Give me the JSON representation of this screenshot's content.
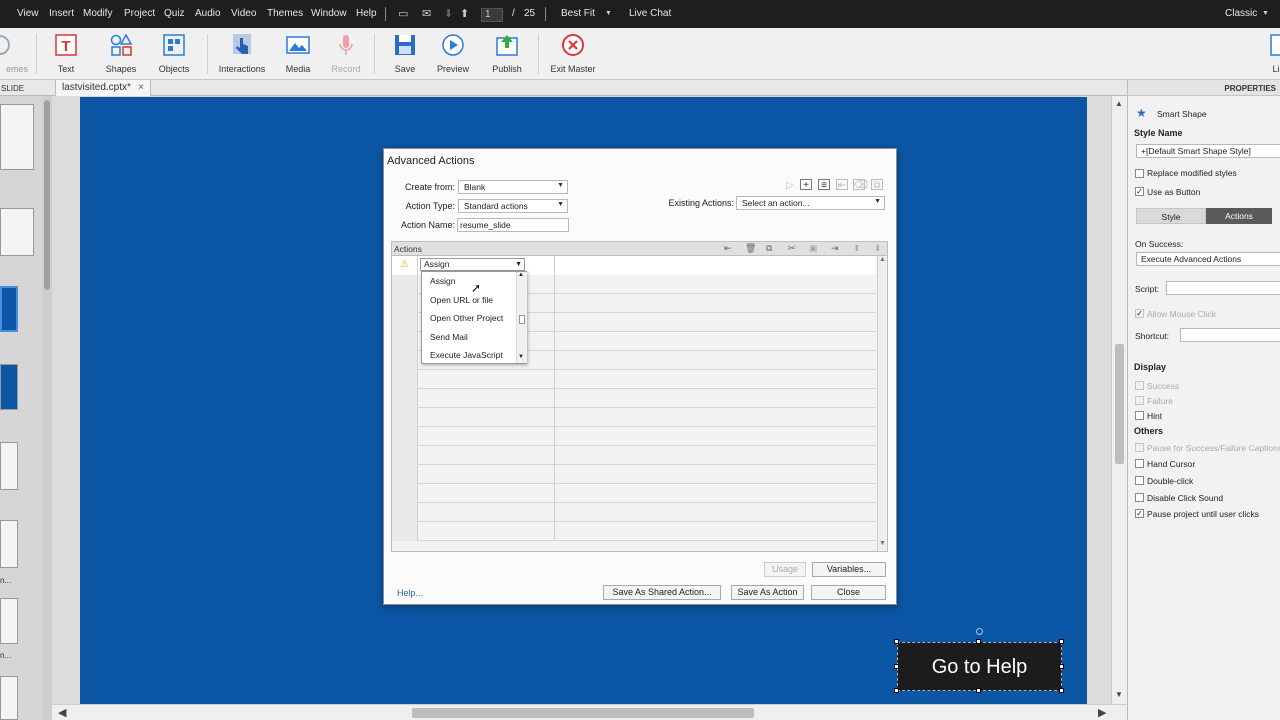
{
  "menubar": {
    "items": [
      "View",
      "Insert",
      "Modify",
      "Project",
      "Quiz",
      "Audio",
      "Video",
      "Themes",
      "Window",
      "Help"
    ],
    "page_current": "1",
    "page_sep": "/",
    "page_total": "25",
    "zoom": "Best Fit",
    "live_chat": "Live Chat",
    "mode": "Classic"
  },
  "toolbar": {
    "left_partial": "emes",
    "text": "Text",
    "shapes": "Shapes",
    "objects": "Objects",
    "interactions": "Interactions",
    "media": "Media",
    "record": "Record",
    "save": "Save",
    "preview": "Preview",
    "publish": "Publish",
    "exit_master": "Exit Master",
    "library": "Library"
  },
  "tabs": {
    "left_panel": "SLIDE",
    "document": "lastvisited.cptx*",
    "close": "×"
  },
  "filmstrip": {
    "labels": [
      "n...",
      "n..."
    ]
  },
  "slide": {
    "button_label": "Go to Help"
  },
  "dialog": {
    "title": "Advanced Actions",
    "create_from_label": "Create from:",
    "create_from_value": "Blank",
    "action_type_label": "Action Type:",
    "action_type_value": "Standard actions",
    "action_name_label": "Action Name:",
    "action_name_value": "resume_slide",
    "existing_actions_label": "Existing Actions:",
    "existing_actions_value": "Select an action...",
    "grid_header": "Actions",
    "row_selected": "Assign",
    "dropdown_options": [
      "Assign",
      "Open URL or file",
      "Open Other Project",
      "Send Mail",
      "Execute JavaScript"
    ],
    "usage": "Usage",
    "variables": "Variables...",
    "help": "Help...",
    "save_shared": "Save As Shared Action...",
    "save_action": "Save As Action",
    "close": "Close"
  },
  "properties": {
    "header": "PROPERTIES",
    "object_type": "Smart Shape",
    "style_name_label": "Style Name",
    "style_name_value": "+[Default Smart Shape Style]",
    "replace_styles": "Replace modified styles",
    "use_as_button": "Use as Button",
    "tab_style": "Style",
    "tab_actions": "Actions",
    "on_success_label": "On Success:",
    "on_success_value": "Execute Advanced Actions",
    "script_label": "Script:",
    "allow_mouse_click": "Allow Mouse Click",
    "shortcut_label": "Shortcut:",
    "display_header": "Display",
    "display_success": "Success",
    "display_failure": "Failure",
    "display_hint": "Hint",
    "others_header": "Others",
    "pause_success": "Pause for Success/Failure Captions",
    "hand_cursor": "Hand Cursor",
    "double_click": "Double-click",
    "disable_click_sound": "Disable Click Sound",
    "pause_project": "Pause project until user clicks"
  },
  "colors": {
    "slide_blue": "#0b57a6",
    "accent": "#2b5fb0",
    "exit_red": "#e0343a"
  }
}
